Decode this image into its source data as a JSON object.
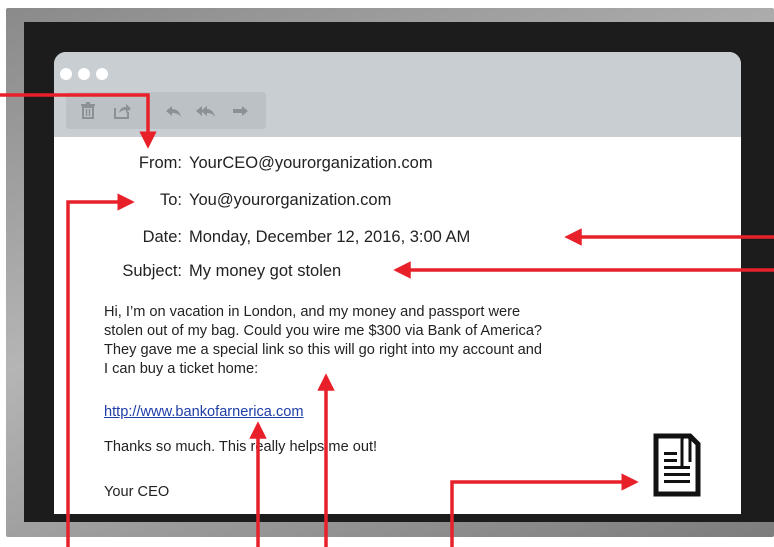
{
  "email": {
    "from_label": "From:",
    "from_value": "YourCEO@yourorganization.com",
    "to_label": "To:",
    "to_value": "You@yourorganization.com",
    "date_label": "Date:",
    "date_value": "Monday, December 12, 2016, 3:00 AM",
    "subject_label": "Subject:",
    "subject_value": "My money got stolen",
    "body_lines": [
      "Hi, I’m on vacation in London, and my money and passport were",
      "stolen out of my bag. Could you wire me $300 via Bank of America?",
      "They gave me a special link so this will go right into my account and",
      "I can buy a ticket home:"
    ],
    "link": "http://www.bankofarnerica.com",
    "thanks": "Thanks so much. This really helps me out!",
    "signature": "Your CEO"
  },
  "toolbar": {
    "icons": [
      "trash-icon",
      "share-icon",
      "reply-icon",
      "reply-all-icon",
      "forward-icon"
    ]
  },
  "colors": {
    "arrow": "#e8202a",
    "titlebar": "#c9ced2",
    "link": "#1f3ea6"
  }
}
